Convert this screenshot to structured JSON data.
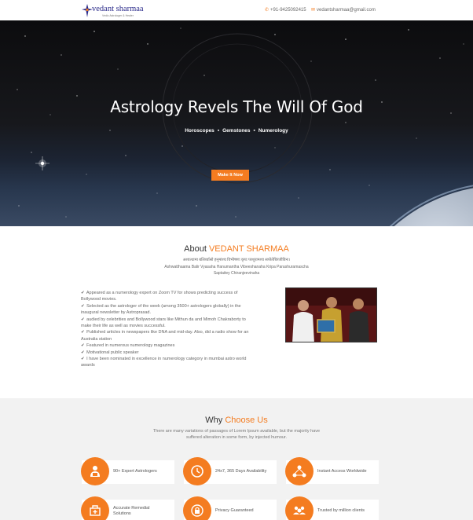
{
  "header": {
    "logo_name": "vedant sharmaa",
    "logo_tagline": "Vedic Astrologer & Healer",
    "phone": "+91-9425092415",
    "email": "vedantsharmaa@gmail.com"
  },
  "hero": {
    "title": "Astrology Revels The Will Of God",
    "services": [
      "Horoscopes",
      "Gemstones",
      "Numerology"
    ],
    "cta": "Make It Now"
  },
  "about": {
    "title_prefix": "About",
    "title_accent": "VEDANT SHARMAA",
    "mantra_line1": "अश्वत्थामा बलिर्व्यासो हनूमांश्च विभीषणः कृपः परशुरामश्च सप्तैतेचिरंजीविनः।",
    "mantra_line2": "Ashwatthaama Balir Vyasaha Hanumantha Vibeeshanaha Kripa Parashuramascha",
    "mantra_line3": "Saptaitey Chiranjeevinaha",
    "bullets": [
      "Appeared as a numerology expert on Zoom TV for shows predicting success of",
      "Bollywood movies.",
      "Selected as the astrologer of the week (among 3500+ astrologers globally) in the",
      "inaugural newsletter by Astroprasad.",
      "audied by celebrities and Bollywood stars like Mithun da and Mimoh Chakraborty to",
      "make their life as well as movies successful.",
      "Published articles in newspapers like DNA and mid-day. Also, did a radio show for an",
      "Australia station",
      "Featured in numerous numerology magazines",
      "Motivational public speaker",
      "I have been nominated in excellence in numerology category in mumbai astro world",
      "awards"
    ]
  },
  "why": {
    "title_prefix": "Why",
    "title_accent": "Choose Us",
    "text_line1": "There are many variations of passages of Lorem Ipsum available, but the majority have",
    "text_line2": "suffered alteration in some form, by injected humour.",
    "features": [
      {
        "label": "90+ Expert Astrologers",
        "icon": "astrologer-icon"
      },
      {
        "label": "24x7, 365 Days Availability",
        "icon": "clock-icon"
      },
      {
        "label": "Instant Access Worldwide",
        "icon": "network-icon"
      },
      {
        "label": "Accurate Remedial Solutions",
        "icon": "remedy-icon"
      },
      {
        "label": "Privacy Guaranteed",
        "icon": "privacy-icon"
      },
      {
        "label": "Trusted by million clients",
        "icon": "clients-icon"
      }
    ]
  },
  "colors": {
    "accent": "#f47c20",
    "hero_dark": "#0c0c0e",
    "section_gray": "#f2f2f2"
  }
}
